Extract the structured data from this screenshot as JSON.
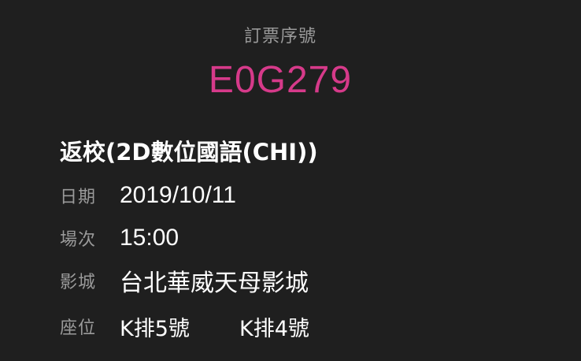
{
  "order": {
    "label": "訂票序號",
    "number": "E0G279",
    "number_color": "#d63a8a"
  },
  "movie": {
    "title": "返校(2D數位國語(CHI))"
  },
  "details": {
    "date_label": "日期",
    "date_value": "2019/10/11",
    "time_label": "場次",
    "time_value": "15:00",
    "cinema_label": "影城",
    "cinema_value": "台北華威天母影城",
    "seat_label": "座位",
    "seats": [
      "K排5號",
      "K排4號"
    ]
  }
}
